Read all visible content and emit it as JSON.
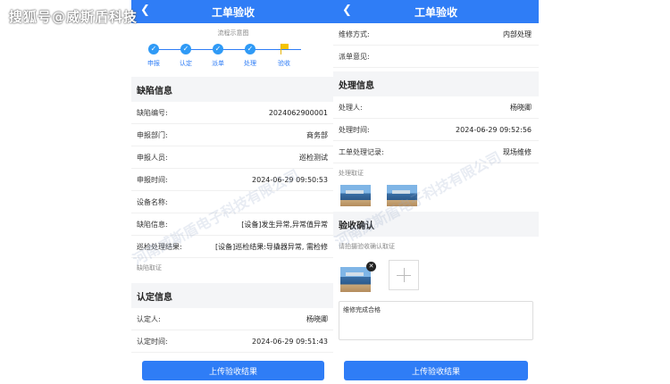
{
  "watermark": "搜狐号@威斯盾科技",
  "watermark_diagonal": "河南威斯盾电子科技有限公司",
  "left": {
    "title": "工单验收",
    "flow_title": "流程示意图",
    "steps": [
      {
        "label": "申报"
      },
      {
        "label": "认定"
      },
      {
        "label": "派单"
      },
      {
        "label": "处理"
      },
      {
        "label": "验收"
      }
    ],
    "defect_section": "缺陷信息",
    "defect_rows": [
      {
        "k": "缺陷编号:",
        "v": "2024062900001"
      },
      {
        "k": "申报部门:",
        "v": "商务部"
      },
      {
        "k": "申报人员:",
        "v": "巡检测试"
      },
      {
        "k": "申报时间:",
        "v": "2024-06-29 09:50:53"
      },
      {
        "k": "设备名称:",
        "v": ""
      },
      {
        "k": "缺陷信息:",
        "v": "[设备]发生异常,异常值异常"
      },
      {
        "k": "巡检处理结果:",
        "v": "[设备]巡检结果:导撬器异常, 需检修"
      }
    ],
    "defect_evidence": "缺陷取证",
    "confirm_section": "认定信息",
    "confirm_rows": [
      {
        "k": "认定人:",
        "v": "杨晓卿"
      },
      {
        "k": "认定时间:",
        "v": "2024-06-29 09:51:43"
      }
    ],
    "submit": "上传验收结果"
  },
  "right": {
    "title": "工单验收",
    "top_rows": [
      {
        "k": "维修方式:",
        "v": "内部处理"
      },
      {
        "k": "派单意见:",
        "v": ""
      }
    ],
    "process_section": "处理信息",
    "process_rows": [
      {
        "k": "处理人:",
        "v": "杨晓卿"
      },
      {
        "k": "处理时间:",
        "v": "2024-06-29 09:52:56"
      },
      {
        "k": "工单处理记录:",
        "v": "现场维修"
      }
    ],
    "process_evidence": "处理取证",
    "accept_section": "验收确认",
    "accept_hint": "请拍摄验收确认取证",
    "remove_glyph": "✕",
    "note_text": "维修完成合格",
    "submit": "上传验收结果"
  },
  "colors": {
    "primary": "#2f7df6",
    "section_bg": "#f4f5f7"
  },
  "icons": {
    "back": "chevron-left-icon",
    "check": "check-icon",
    "flag": "flag-icon",
    "add": "plus-icon",
    "remove": "close-icon"
  }
}
